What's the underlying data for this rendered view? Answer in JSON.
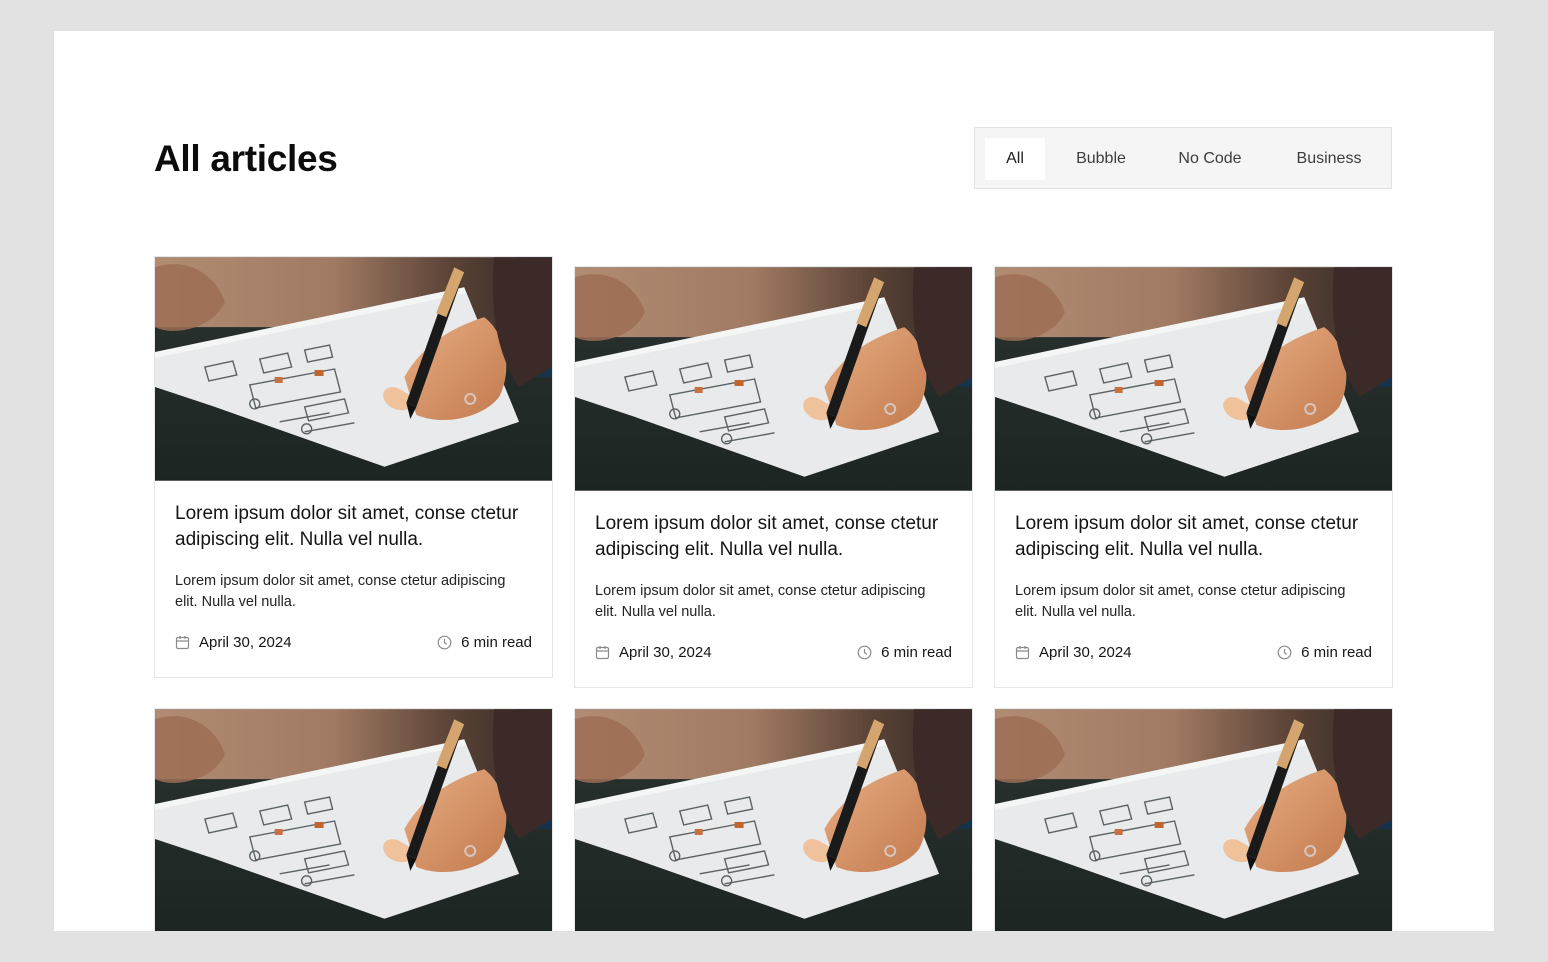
{
  "page": {
    "title": "All articles"
  },
  "filters": [
    {
      "label": "All",
      "active": true
    },
    {
      "label": "Bubble",
      "active": false
    },
    {
      "label": "No Code",
      "active": false
    },
    {
      "label": "Business",
      "active": false
    }
  ],
  "articles": [
    {
      "title": "Lorem ipsum dolor sit amet, conse ctetur adipiscing elit. Nulla vel nulla.",
      "excerpt": "Lorem ipsum dolor sit amet, conse ctetur adipiscing elit. Nulla vel nulla.",
      "date": "April 30, 2024",
      "read_time": "6 min read"
    },
    {
      "title": "Lorem ipsum dolor sit amet, conse ctetur adipiscing elit. Nulla vel nulla.",
      "excerpt": "Lorem ipsum dolor sit amet, conse ctetur adipiscing elit. Nulla vel nulla.",
      "date": "April 30, 2024",
      "read_time": "6 min read"
    },
    {
      "title": "Lorem ipsum dolor sit amet, conse ctetur adipiscing elit. Nulla vel nulla.",
      "excerpt": "Lorem ipsum dolor sit amet, conse ctetur adipiscing elit. Nulla vel nulla.",
      "date": "April 30, 2024",
      "read_time": "6 min read"
    },
    {
      "title": "",
      "excerpt": "",
      "date": "",
      "read_time": ""
    },
    {
      "title": "",
      "excerpt": "",
      "date": "",
      "read_time": ""
    },
    {
      "title": "",
      "excerpt": "",
      "date": "",
      "read_time": ""
    }
  ],
  "icons": {
    "date": "calendar-icon",
    "read_time": "clock-icon"
  },
  "colors": {
    "background": "#e2e2e2",
    "panel": "#ffffff",
    "filter_bar": "#f5f5f5",
    "filter_active": "#ffffff"
  }
}
